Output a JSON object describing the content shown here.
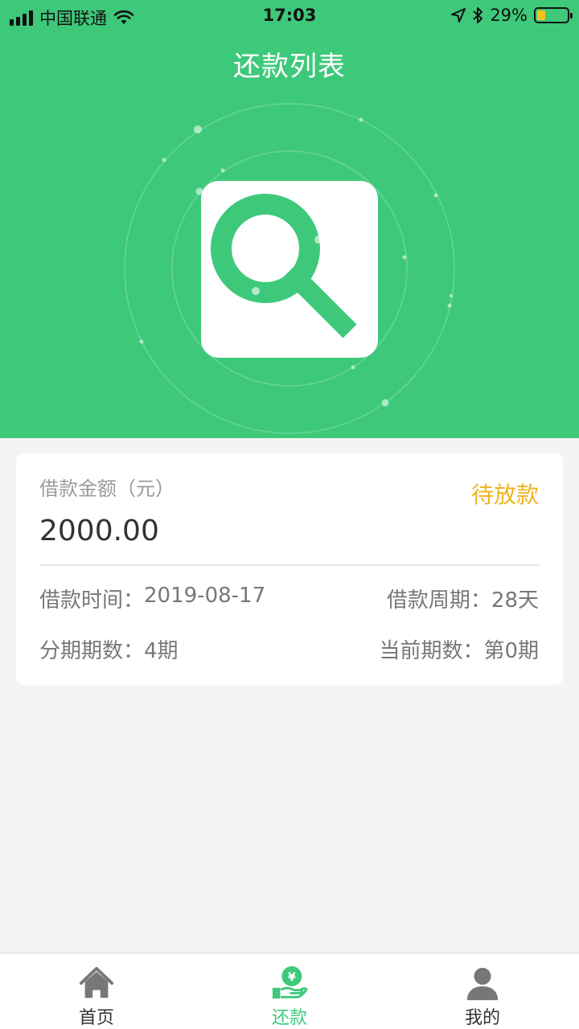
{
  "status_bar": {
    "carrier": "中国联通",
    "time": "17:03",
    "battery_percent": "29%",
    "battery_level": 0.29
  },
  "header": {
    "title": "还款列表",
    "illustration_icon": "search-icon"
  },
  "loan_card": {
    "amount_label": "借款金额（元）",
    "amount_value": "2000.00",
    "status": "待放款",
    "loan_time_label": "借款时间：",
    "loan_time_value": "2019-08-17",
    "loan_period_label": "借款周期：",
    "loan_period_value": "28天",
    "installments_label": "分期期数：",
    "installments_value": "4期",
    "current_period_label": "当前期数：",
    "current_period_value": "第0期"
  },
  "tab_bar": {
    "items": [
      {
        "label": "首页",
        "icon": "home-icon",
        "active": false
      },
      {
        "label": "还款",
        "icon": "repay-icon",
        "active": true
      },
      {
        "label": "我的",
        "icon": "user-icon",
        "active": false
      }
    ]
  },
  "colors": {
    "brand_green": "#3ec97a",
    "status_orange": "#f0b41c",
    "battery_yellow": "#f7c21b"
  }
}
